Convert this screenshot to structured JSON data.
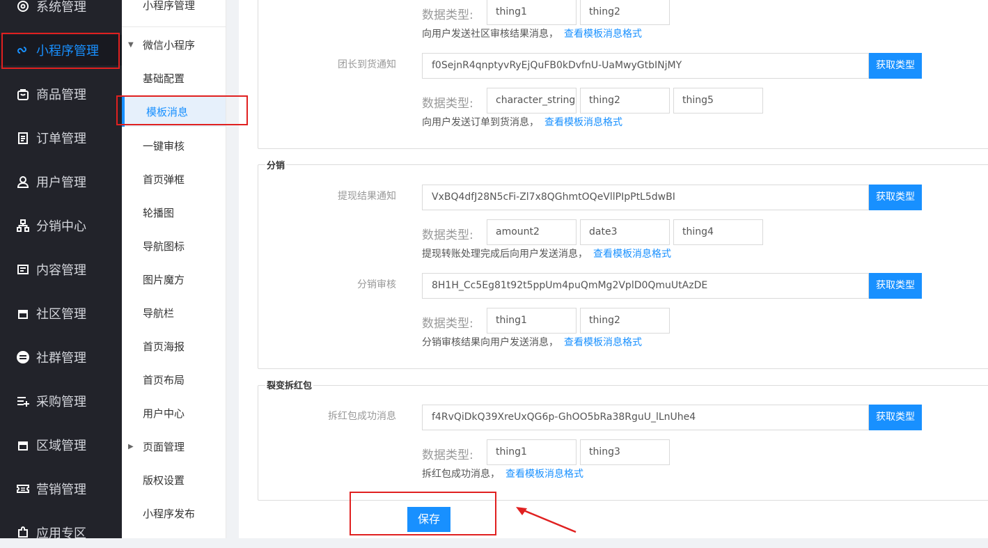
{
  "main_nav": [
    {
      "label": "系统管理",
      "icon": "gear-icon"
    },
    {
      "label": "小程序管理",
      "icon": "link-icon"
    },
    {
      "label": "商品管理",
      "icon": "bag-icon"
    },
    {
      "label": "订单管理",
      "icon": "clipboard-icon"
    },
    {
      "label": "用户管理",
      "icon": "user-icon"
    },
    {
      "label": "分销中心",
      "icon": "org-chart-icon"
    },
    {
      "label": "内容管理",
      "icon": "content-icon"
    },
    {
      "label": "社区管理",
      "icon": "store-icon"
    },
    {
      "label": "社群管理",
      "icon": "minus-circle-icon"
    },
    {
      "label": "采购管理",
      "icon": "list-add-icon"
    },
    {
      "label": "区域管理",
      "icon": "store-icon"
    },
    {
      "label": "营销管理",
      "icon": "ticket-icon"
    },
    {
      "label": "应用专区",
      "icon": "puzzle-icon"
    }
  ],
  "sub_nav": {
    "top": "小程序管理",
    "items": [
      {
        "label": "微信小程序"
      },
      {
        "label": "基础配置"
      },
      {
        "label": "模板消息"
      },
      {
        "label": "一键审核"
      },
      {
        "label": "首页弹框"
      },
      {
        "label": "轮播图"
      },
      {
        "label": "导航图标"
      },
      {
        "label": "图片魔方"
      },
      {
        "label": "导航栏"
      },
      {
        "label": "首页海报"
      },
      {
        "label": "首页布局"
      },
      {
        "label": "用户中心"
      },
      {
        "label": "页面管理"
      },
      {
        "label": "版权设置"
      },
      {
        "label": "小程序发布"
      }
    ]
  },
  "common": {
    "data_type_label": "数据类型:",
    "view_format_link": "查看模板消息格式",
    "get_type_button": "获取类型"
  },
  "section1": {
    "top_types": [
      "thing1",
      "thing2"
    ],
    "top_hint": "向用户发送社区审核结果消息，",
    "row": {
      "label": "团长到货通知",
      "template_id": "f0SejnR4qnptyvRyEjQuFB0kDvfnU-UaMwyGtbINjMY",
      "types": [
        "character_string",
        "thing2",
        "thing5"
      ],
      "hint": "向用户发送订单到货消息，"
    }
  },
  "section2": {
    "title": "分销",
    "rows": [
      {
        "label": "提现结果通知",
        "template_id": "VxBQ4dfJ28N5cFi-Zl7x8QGhmtOQeVllPIpPtL5dwBI",
        "types": [
          "amount2",
          "date3",
          "thing4"
        ],
        "hint": "提现转账处理完成后向用户发送消息，"
      },
      {
        "label": "分销审核",
        "template_id": "8H1H_Cc5Eg81t92t5ppUm4puQmMg2VplD0QmuUtAzDE",
        "types": [
          "thing1",
          "thing2"
        ],
        "hint": "分销审核结果向用户发送消息，"
      }
    ]
  },
  "section3": {
    "title": "裂变拆红包",
    "row": {
      "label": "拆红包成功消息",
      "template_id": "f4RvQiDkQ39XreUxQG6p-GhOO5bRa38RguU_lLnUhe4",
      "types": [
        "thing1",
        "thing3"
      ],
      "hint": "拆红包成功消息，"
    }
  },
  "save_button": "保存",
  "colors": {
    "primary": "#1890ff",
    "sidebar": "#22232a",
    "highlight_box": "#e02020"
  }
}
